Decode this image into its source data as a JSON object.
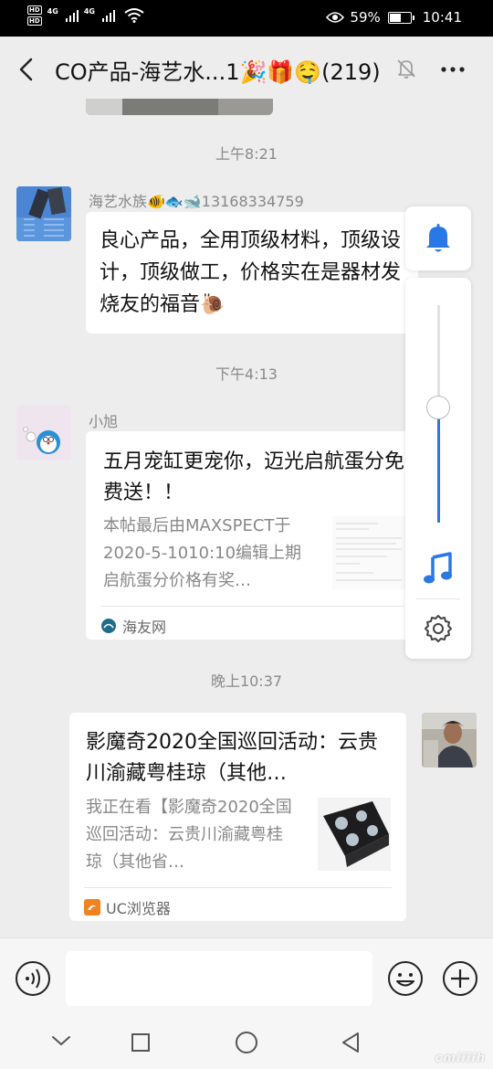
{
  "status_bar": {
    "sim1_label": "HD",
    "sim2_label": "HD",
    "net1": "4G",
    "net2": "4G",
    "battery_percent": "59%",
    "battery_level": 0.59,
    "time": "10:41"
  },
  "header": {
    "title": "CO产品-海艺水...1🎉🎁🤤(219)",
    "back_icon": "back-arrow-icon",
    "mute_icon": "bell-off-icon",
    "more_icon": "more-dots-icon"
  },
  "messages": [
    {
      "timestamp": "上午8:21",
      "sender": "海艺水族🐠🐟🐋13168334759",
      "text": "良心产品，全用顶级材料，顶级设计，顶级做工，价格实在是器材发烧友的福音🐌"
    },
    {
      "timestamp": "下午4:13",
      "sender": "小旭",
      "card": {
        "title": "五月宠缸更宠你，迈光启航蛋分免费送！！",
        "desc": "本帖最后由MAXSPECT于2020-5-1010:10编辑上期启航蛋分价格有奖…",
        "source": "海友网"
      }
    },
    {
      "timestamp": "晚上10:37",
      "card": {
        "title": "影魔奇2020全国巡回活动：云贵川渝藏粤桂琼（其他…",
        "desc": "我正在看【影魔奇2020全国巡回活动：云贵川渝藏粤桂琼（其他省…",
        "source": "UC浏览器"
      }
    }
  ],
  "floating_panel": {
    "bell_icon": "bell-icon",
    "volume_level": 0.53,
    "music_icon": "music-note-icon",
    "settings_icon": "gear-icon"
  },
  "input_bar": {
    "voice_icon": "voice-icon",
    "emoji_icon": "emoji-icon",
    "plus_icon": "plus-icon",
    "value": ""
  },
  "nav_bar": {
    "icons": [
      "hide-keyboard-icon",
      "recents-icon",
      "home-icon",
      "back-icon"
    ]
  },
  "watermark": "cmiiiih",
  "colors": {
    "accent_blue": "#2a78e6",
    "chat_background": "#ededed",
    "bubble": "#ffffff"
  }
}
